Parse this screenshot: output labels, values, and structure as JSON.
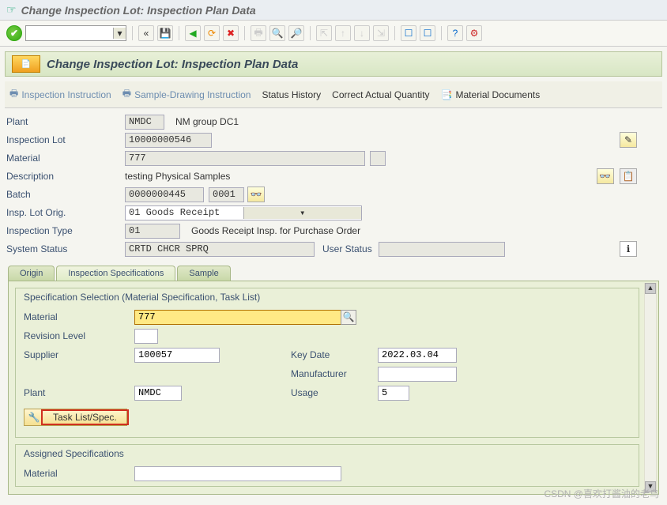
{
  "window": {
    "title": "Change Inspection Lot: Inspection Plan Data"
  },
  "toolbar": {
    "back_icon": "«",
    "save_icon": "💾",
    "nav_back": "◀",
    "nav_fwd": "▶",
    "nav_cancel": "✖",
    "print": "🖨",
    "find": "🔍",
    "page1": "⇱",
    "page2": "⇲",
    "layout1": "☐",
    "layout2": "☐",
    "help": "?",
    "tool": "⚙"
  },
  "subheader": {
    "title": "Change Inspection Lot: Inspection Plan Data"
  },
  "actions": {
    "inspection_instruction": "Inspection Instruction",
    "sample_drawing": "Sample-Drawing Instruction",
    "status_history": "Status History",
    "correct_qty": "Correct Actual Quantity",
    "material_docs": "Material Documents"
  },
  "form": {
    "plant_label": "Plant",
    "plant": "NMDC",
    "plant_desc": "NM group DC1",
    "inspection_lot_label": "Inspection Lot",
    "inspection_lot": "10000000546",
    "material_label": "Material",
    "material": "777",
    "description_label": "Description",
    "description": "testing Physical Samples",
    "batch_label": "Batch",
    "batch": "0000000445",
    "batch_split": "0001",
    "insp_orig_label": "Insp. Lot Orig.",
    "insp_orig": "01 Goods Receipt",
    "insp_type_label": "Inspection Type",
    "insp_type": "01",
    "insp_type_desc": "Goods Receipt Insp. for Purchase Order",
    "sys_status_label": "System Status",
    "sys_status": "CRTD CHCR SPRQ",
    "user_status_label": "User Status",
    "user_status": ""
  },
  "tabs": {
    "origin": "Origin",
    "insp_spec": "Inspection Specifications",
    "sample": "Sample"
  },
  "spec": {
    "group_title": "Specification Selection (Material Specification, Task List)",
    "material_label": "Material",
    "material": "777",
    "revision_label": "Revision Level",
    "revision": "",
    "supplier_label": "Supplier",
    "supplier": "100057",
    "keydate_label": "Key Date",
    "keydate": "2022.03.04",
    "manufacturer_label": "Manufacturer",
    "manufacturer": "",
    "plant_label": "Plant",
    "plant": "NMDC",
    "usage_label": "Usage",
    "usage": "5",
    "tasklist_btn": "Task List/Spec.",
    "assigned_title": "Assigned Specifications",
    "assigned_material_label": "Material",
    "assigned_material": ""
  },
  "watermark": "CSDN @喜欢打酱油的老鸟"
}
